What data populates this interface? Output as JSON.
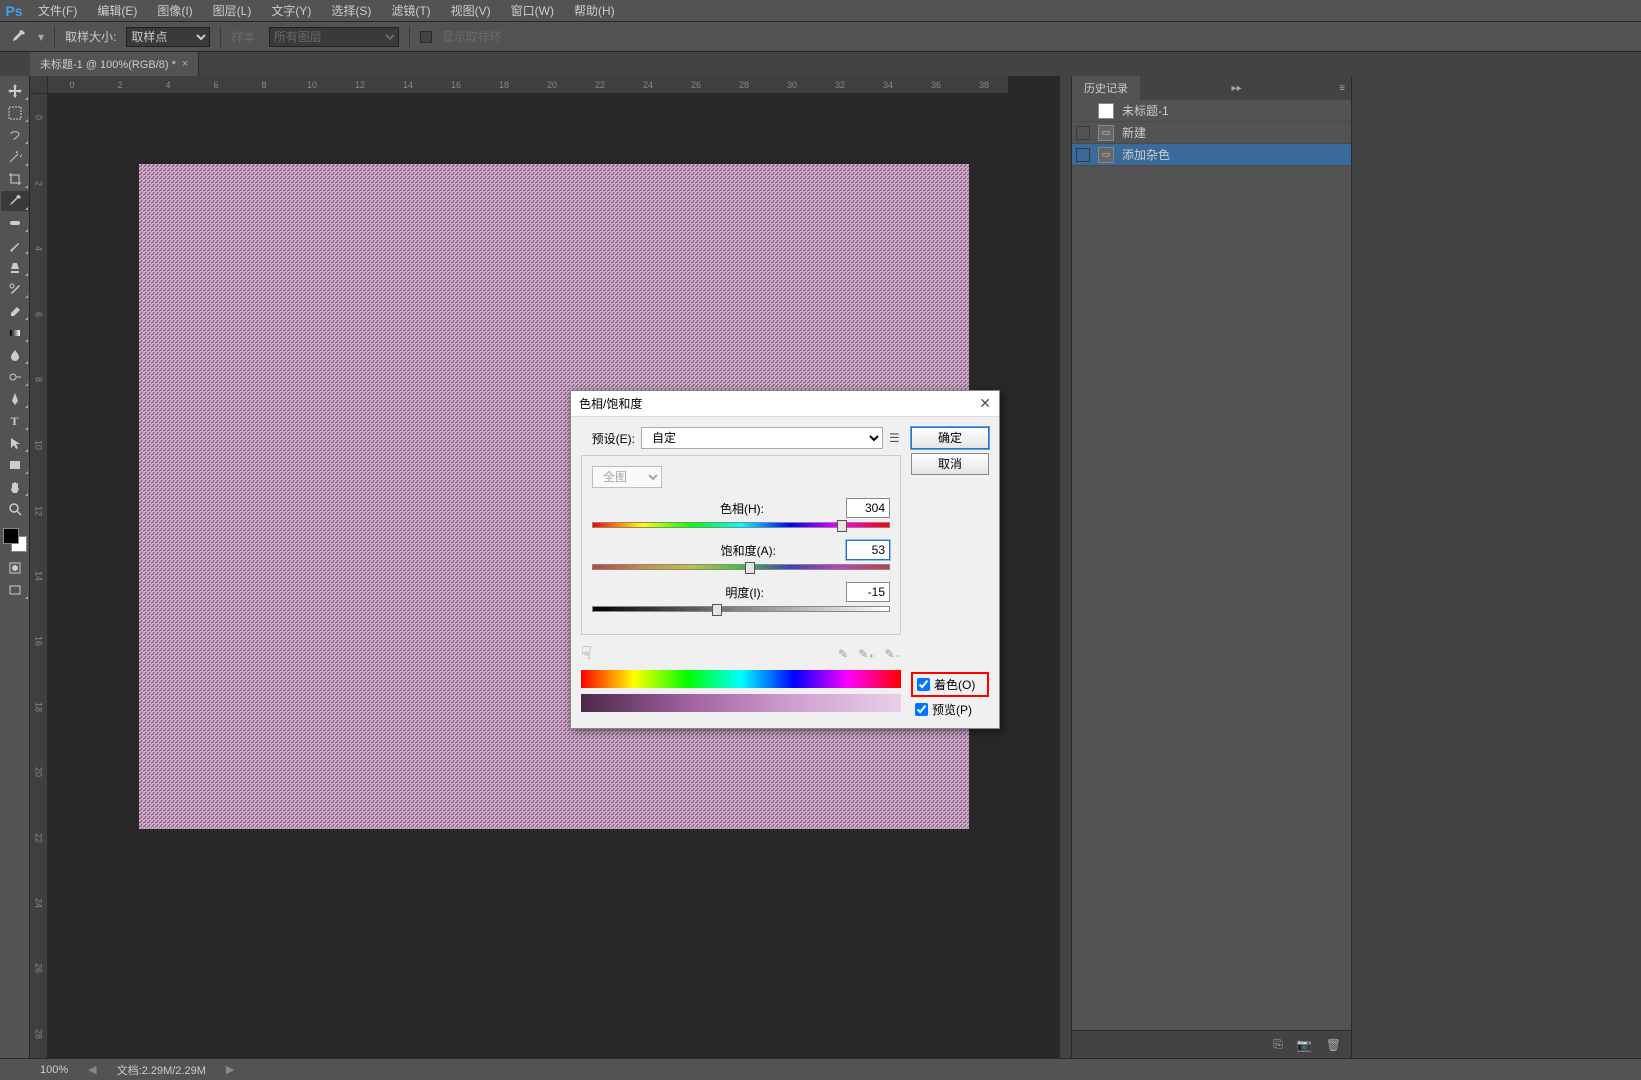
{
  "app": {
    "logo": "Ps"
  },
  "menu": {
    "file": "文件(F)",
    "edit": "编辑(E)",
    "image": "图像(I)",
    "layer": "图层(L)",
    "type": "文字(Y)",
    "select": "选择(S)",
    "filter": "滤镜(T)",
    "view": "视图(V)",
    "window": "窗口(W)",
    "help": "帮助(H)"
  },
  "options": {
    "sample_size_label": "取样大小:",
    "sample_size_value": "取样点",
    "sample_label": "样本:",
    "sample_value": "所有图层",
    "show_ring": "显示取样环"
  },
  "tab": {
    "title": "未标题-1 @ 100%(RGB/8) *"
  },
  "rulers": {
    "h": [
      "0",
      "2",
      "4",
      "6",
      "8",
      "10",
      "12",
      "14",
      "16",
      "18",
      "20",
      "22",
      "24",
      "26",
      "28",
      "30",
      "32",
      "34",
      "36",
      "38"
    ],
    "v": [
      "0",
      "2",
      "4",
      "6",
      "8",
      "10",
      "12",
      "14",
      "16",
      "18",
      "20",
      "22",
      "24",
      "26",
      "28"
    ]
  },
  "panels": {
    "history": {
      "title": "历史记录",
      "doc": "未标题-1",
      "items": [
        {
          "label": "新建"
        },
        {
          "label": "添加杂色"
        }
      ]
    }
  },
  "status": {
    "zoom": "100%",
    "docinfo": "文档:2.29M/2.29M"
  },
  "dialog": {
    "title": "色相/饱和度",
    "preset_label": "预设(E):",
    "preset_value": "自定",
    "channel": "全图",
    "hue_label": "色相(H):",
    "hue_value": "304",
    "sat_label": "饱和度(A):",
    "sat_value": "53",
    "light_label": "明度(I):",
    "light_value": "-15",
    "colorize": "着色(O)",
    "preview": "预览(P)",
    "ok": "确定",
    "cancel": "取消"
  }
}
